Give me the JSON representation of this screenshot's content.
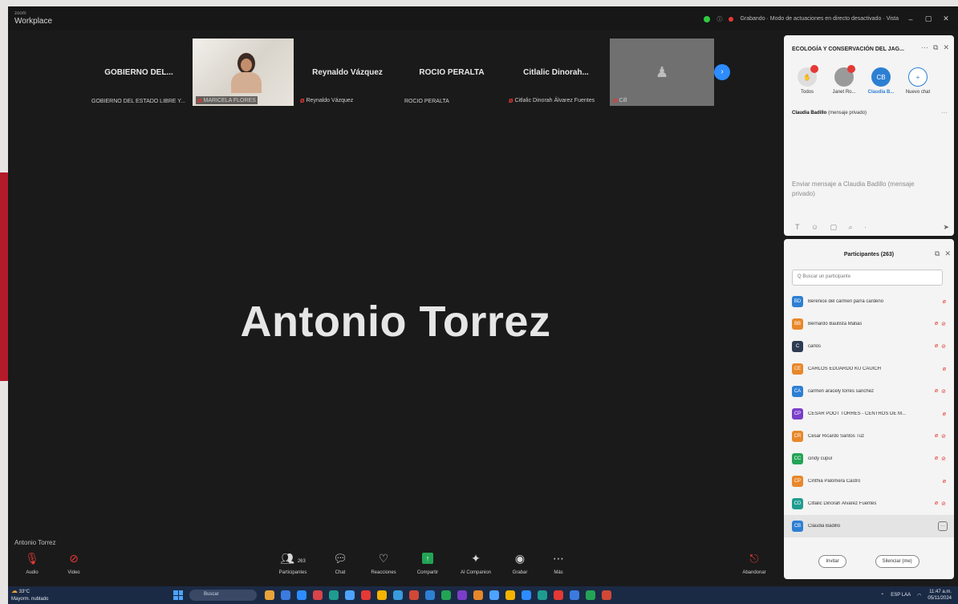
{
  "app": {
    "brand_small": "zoom",
    "brand_name": "Workplace"
  },
  "titlebar": {
    "status_text": "Grabando · Modo de actuaciones en directo desactivado · Vista"
  },
  "strip": {
    "tiles": [
      {
        "name": "GOBIERNO DEL...",
        "label": "GOBIERNO DEL ESTADO LIBRE Y...",
        "muted": false
      },
      {
        "name": "",
        "label": "MARICELA FLORES",
        "muted": true,
        "video": true
      },
      {
        "name": "Reynaldo Vázquez",
        "label": "Reynaldo Vázquez",
        "muted": true
      },
      {
        "name": "ROCIO PERALTA",
        "label": "ROCIO PERALTA",
        "muted": false
      },
      {
        "name": "Citlalic Dinorah...",
        "label": "Citlalic Dinorah Álvarez Fuentes",
        "muted": true
      },
      {
        "name": "",
        "label": "Cill",
        "muted": true,
        "gray": true
      }
    ],
    "next_label": "›"
  },
  "speaker": {
    "name": "Antonio Torrez",
    "label": "Antonio Torrez"
  },
  "chat": {
    "title": "ECOLOGÍA Y CONSERVACIÓN DEL JAG...",
    "recipients": [
      {
        "initials": "✋",
        "label": "Todos"
      },
      {
        "initials": "",
        "label": "Janet Ro..."
      },
      {
        "initials": "CB",
        "label": "Claudia B..."
      },
      {
        "initials": "+",
        "label": "Nuevo chat"
      }
    ],
    "to_name": "Claudia Badillo",
    "to_suffix": "(mensaje privado)",
    "placeholder": "Enviar mensaje a Claudia Badillo (mensaje privado)",
    "tools": "T ☺ ▢ ⌕ ·",
    "send": "➤"
  },
  "participants": {
    "title": "Participantes (263)",
    "search_placeholder": "Q Buscar un participante",
    "rows": [
      {
        "initials": "BD",
        "name": "Berenice del carmen parra cardeno",
        "color": "#2d7fd3",
        "mic": true,
        "cam": false
      },
      {
        "initials": "BB",
        "name": "Bernardo Bautista Matias",
        "color": "#e8872a",
        "mic": true,
        "cam": true
      },
      {
        "initials": "C",
        "name": "carlos",
        "color": "#2f3b52",
        "mic": true,
        "cam": true
      },
      {
        "initials": "CE",
        "name": "CARLOS EDUARDO KU CAUICH",
        "color": "#e8872a",
        "mic": true,
        "cam": false
      },
      {
        "initials": "CA",
        "name": "carmen aracely torres sanchez",
        "color": "#2d7fd3",
        "mic": true,
        "cam": true
      },
      {
        "initials": "CP",
        "name": "CESAR POOT TORRES - CENTROS DE M...",
        "color": "#7a3ec8",
        "mic": true,
        "cam": false
      },
      {
        "initials": "CR",
        "name": "Cesar Ricardo Santos Tuz",
        "color": "#e8872a",
        "mic": true,
        "cam": true
      },
      {
        "initials": "CC",
        "name": "cindy cupul",
        "color": "#23a455",
        "mic": true,
        "cam": true
      },
      {
        "initials": "CP",
        "name": "Cinthia Palomera Castro",
        "color": "#e8872a",
        "mic": true,
        "cam": false
      },
      {
        "initials": "CD",
        "name": "Citlalic Dinorah Álvarez Fuentes",
        "color": "#1f9c8f",
        "mic": true,
        "cam": true
      },
      {
        "initials": "CB",
        "name": "Claudia Badillo",
        "color": "#2d7fd3",
        "mic": false,
        "cam": false,
        "selected": true
      }
    ],
    "invite_label": "Invitar",
    "mute_label": "Silenciar (me)"
  },
  "controls": {
    "audio": "Audio",
    "video": "Video",
    "participants": "Participantes",
    "participants_count": "263",
    "chat": "Chat",
    "reactions": "Reacciones",
    "share": "Compartir",
    "ai": "AI Companion",
    "record": "Grabar",
    "more": "Más",
    "leave": "Abandonar"
  },
  "taskbar": {
    "weather_temp": "33°C",
    "weather_desc": "Mayorm. nublado",
    "search": "Buscar",
    "lang": "ESP LAA",
    "time": "11:47 a.m.",
    "date": "05/11/2024"
  },
  "colors": {
    "accent": "#2d8cff",
    "mute": "#e53935",
    "meeting_bg": "#1a1a1a"
  }
}
